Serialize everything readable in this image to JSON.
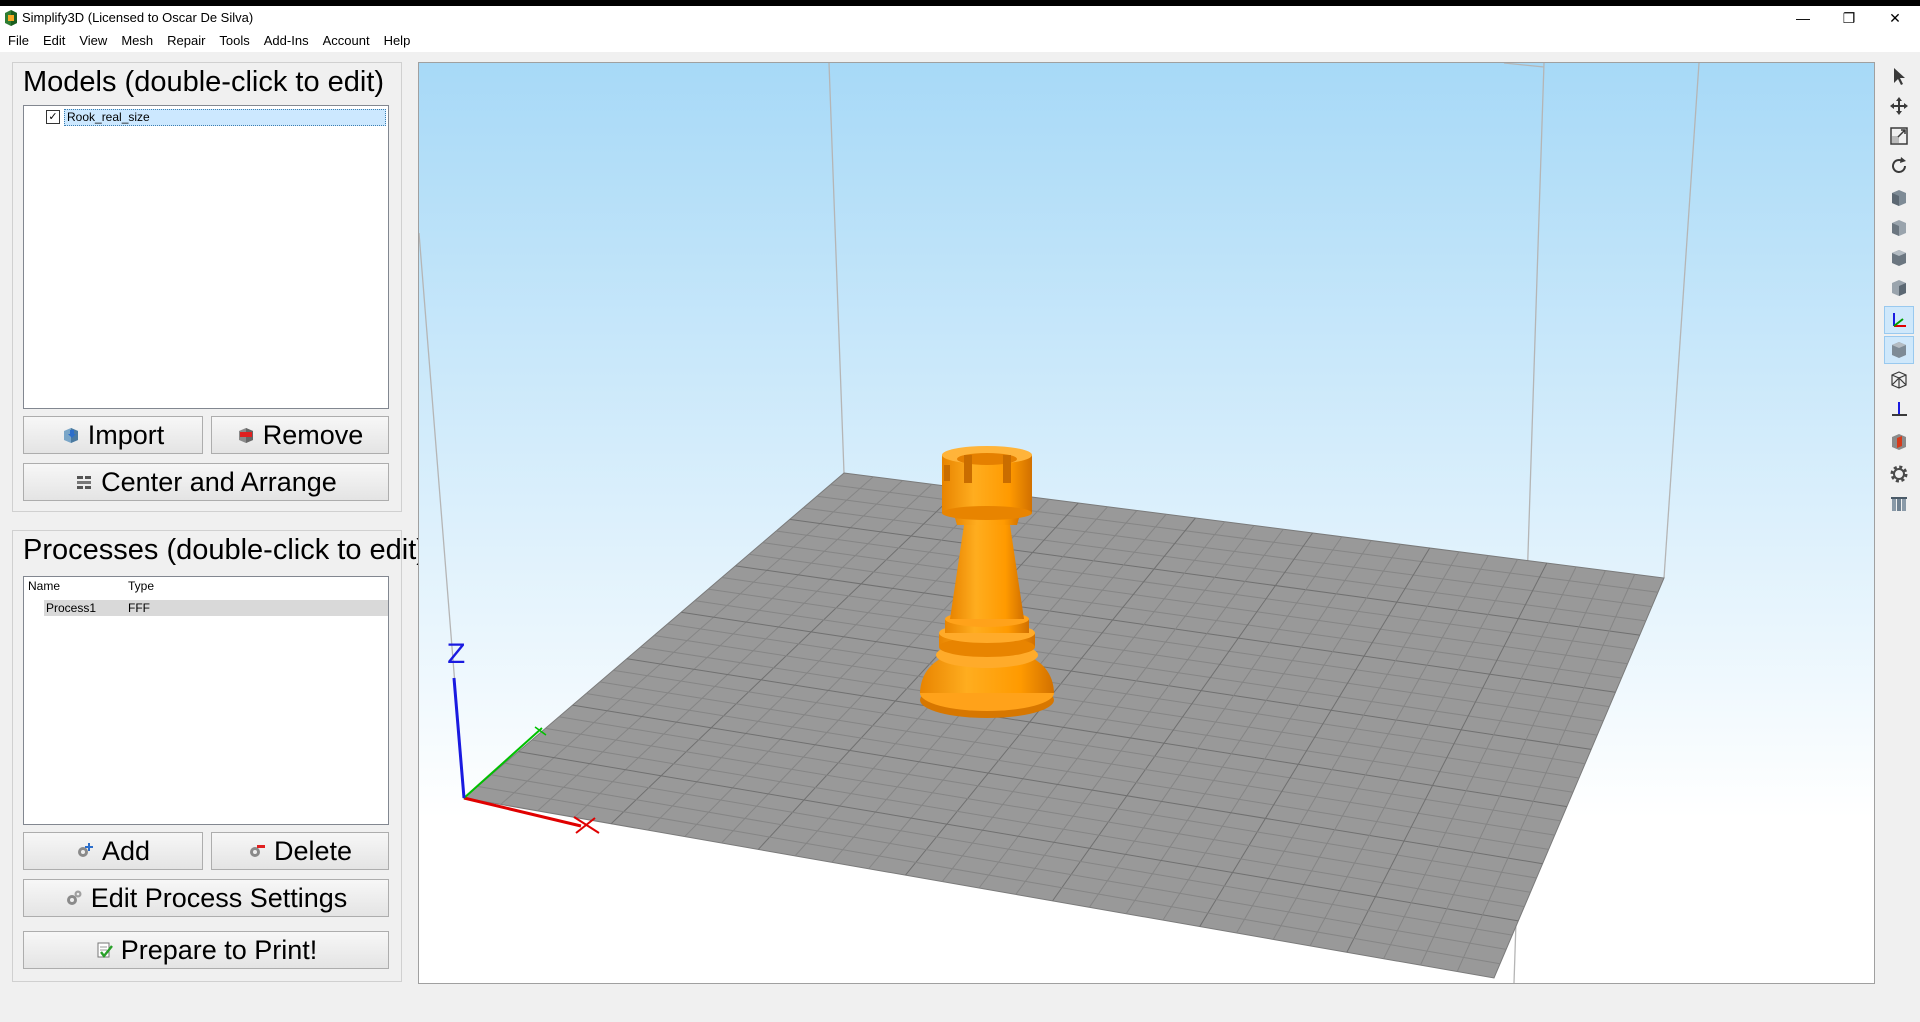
{
  "window": {
    "title": "Simplify3D (Licensed to Oscar De Silva)",
    "controls": {
      "minimize": "—",
      "restore": "❐",
      "close": "✕"
    }
  },
  "menu": [
    "File",
    "Edit",
    "View",
    "Mesh",
    "Repair",
    "Tools",
    "Add-Ins",
    "Account",
    "Help"
  ],
  "models": {
    "title": "Models (double-click to edit)",
    "items": [
      {
        "label": "Rook_real_size",
        "checked": true
      }
    ],
    "import_label": "Import",
    "remove_label": "Remove",
    "arrange_label": "Center and Arrange"
  },
  "processes": {
    "title": "Processes (double-click to edit)",
    "columns": [
      "Name",
      "Type"
    ],
    "rows": [
      {
        "name": "Process1",
        "type": "FFF"
      }
    ],
    "add_label": "Add",
    "delete_label": "Delete",
    "edit_label": "Edit Process Settings",
    "prepare_label": "Prepare to Print!"
  },
  "viewport": {
    "axis_z_label": "Z",
    "colors": {
      "bed": "#999999",
      "grid": "#858585",
      "model": "#ff9a00",
      "model_dark": "#d77700",
      "x_axis": "#e00000",
      "y_axis": "#00c000",
      "z_axis": "#1a1ae0",
      "sky": "#a7d9f7"
    }
  },
  "toolbar_icons": [
    "select-icon",
    "move-icon",
    "scale-icon",
    "rotate-icon",
    "view-default-icon",
    "view-front-icon",
    "view-top-icon",
    "view-side-icon",
    "axes-icon",
    "solid-view-icon",
    "wireframe-icon",
    "bed-icon",
    "cross-section-icon",
    "settings-icon",
    "tools-icon"
  ]
}
